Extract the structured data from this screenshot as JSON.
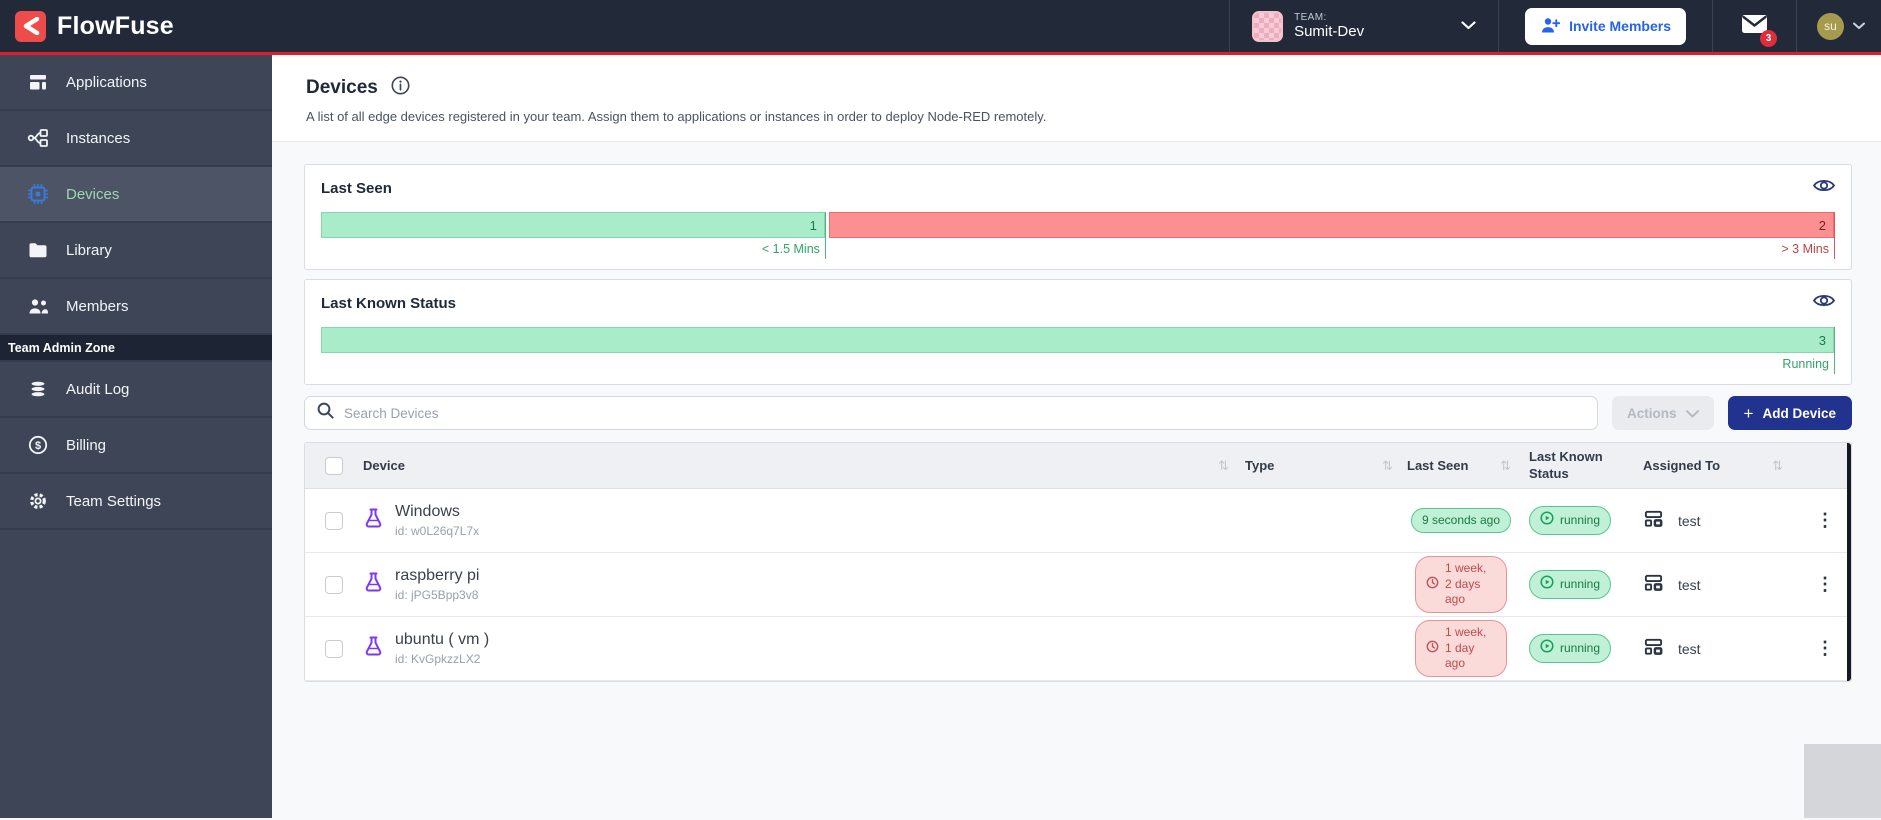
{
  "navbar": {
    "logo_text": "FlowFuse",
    "team": {
      "label": "TEAM:",
      "name": "Sumit-Dev"
    },
    "invite_label": "Invite Members",
    "mail_badge": "3",
    "avatar_initials": "su"
  },
  "sidebar": {
    "items": [
      {
        "label": "Applications"
      },
      {
        "label": "Instances"
      },
      {
        "label": "Devices"
      },
      {
        "label": "Library"
      },
      {
        "label": "Members"
      }
    ],
    "admin_section_label": "Team Admin Zone",
    "admin_items": [
      {
        "label": "Audit Log"
      },
      {
        "label": "Billing"
      },
      {
        "label": "Team Settings"
      }
    ]
  },
  "page": {
    "title": "Devices",
    "description": "A list of all edge devices registered in your team. Assign them to applications or instances in order to deploy Node-RED remotely."
  },
  "chart_data": [
    {
      "type": "bar",
      "title": "Last Seen",
      "segments": [
        {
          "label": "< 1.5 Mins",
          "value": 1,
          "color": "#a9ecc9"
        },
        {
          "label": "> 3 Mins",
          "value": 2,
          "color": "#fc8f8f"
        }
      ]
    },
    {
      "type": "bar",
      "title": "Last Known Status",
      "segments": [
        {
          "label": "Running",
          "value": 3,
          "color": "#a9ecc9"
        }
      ]
    }
  ],
  "toolbar": {
    "search_placeholder": "Search Devices",
    "actions_label": "Actions",
    "add_device_label": "Add Device"
  },
  "table": {
    "headers": {
      "device": "Device",
      "type": "Type",
      "last_seen": "Last Seen",
      "last_known_status": "Last Known Status",
      "assigned_to": "Assigned To"
    },
    "rows": [
      {
        "name": "Windows",
        "device_id": "id: w0L26q7L7x",
        "type": "",
        "last_seen": "9 seconds ago",
        "last_seen_state": "recent",
        "status": "running",
        "assigned_to": "test"
      },
      {
        "name": "raspberry pi",
        "device_id": "id: jPG5Bpp3v8",
        "type": "",
        "last_seen": "1 week, 2 days ago",
        "last_seen_state": "stale",
        "status": "running",
        "assigned_to": "test"
      },
      {
        "name": "ubuntu ( vm )",
        "device_id": "id: KvGpkzzLX2",
        "type": "",
        "last_seen": "1 week, 1 day ago",
        "last_seen_state": "stale",
        "status": "running",
        "assigned_to": "test"
      }
    ]
  },
  "icons": {
    "sort": "⇅",
    "kebab": "⋮",
    "plus": "+"
  },
  "colors": {
    "accent_red": "#e11d2c",
    "navbar_bg": "#222a3a",
    "sidebar_bg": "#3e4557",
    "active_icon_blue": "#3c79da",
    "active_text_green": "#9bd8ae",
    "success_bg": "#c0f1d6",
    "success_border": "#56c78c",
    "success_text": "#177a44",
    "danger_bg": "#fbdada",
    "danger_border": "#e89494",
    "danger_text": "#bf4a4a",
    "primary_button": "#22338f"
  }
}
